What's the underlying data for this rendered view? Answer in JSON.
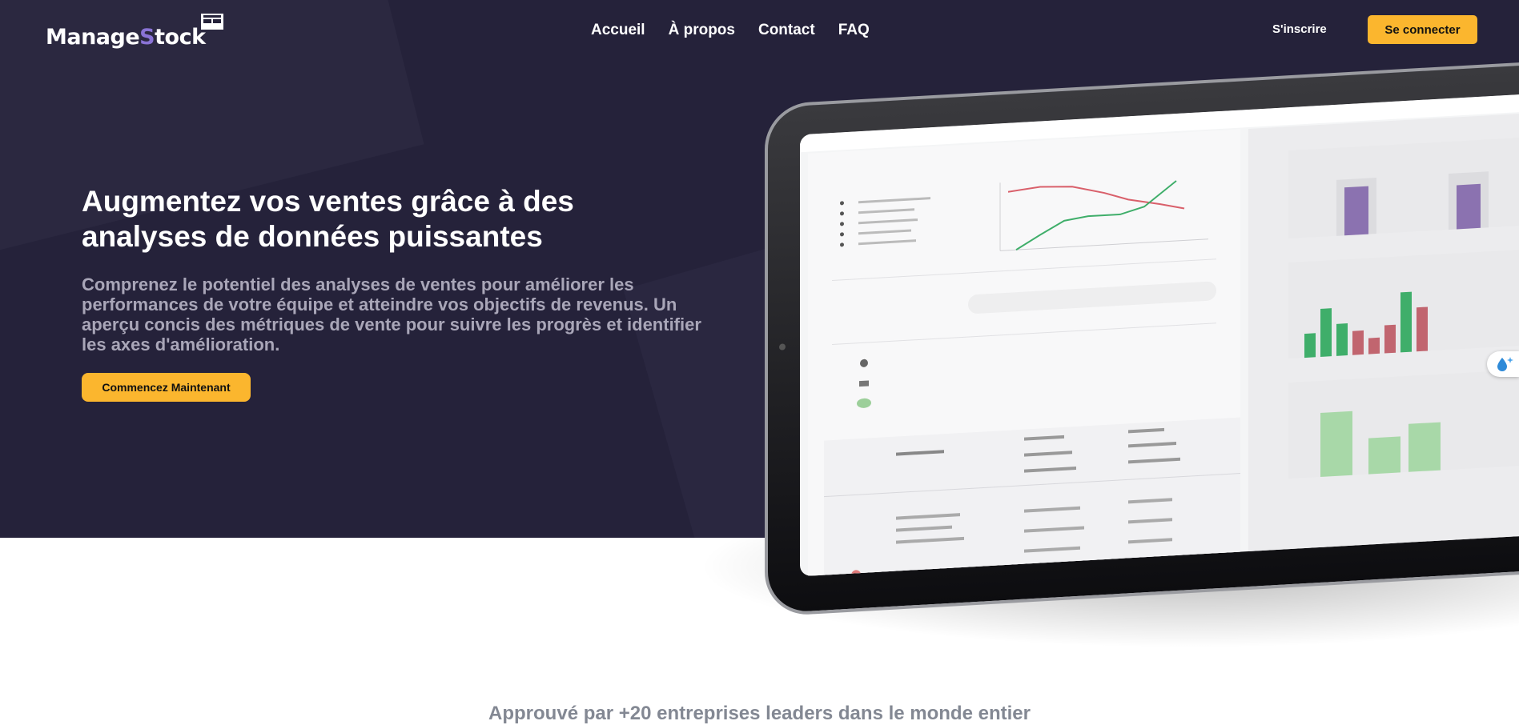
{
  "brand": {
    "name_part1": "Manage",
    "name_accent": "S",
    "name_part2": "tock",
    "accent_color": "#8a73d6",
    "logo_icon": "window-grid-icon"
  },
  "nav": {
    "links": [
      {
        "label": "Accueil"
      },
      {
        "label": "À propos"
      },
      {
        "label": "Contact"
      },
      {
        "label": "FAQ"
      }
    ],
    "signup_label": "S'inscrire",
    "login_label": "Se connecter"
  },
  "hero": {
    "title": "Augmentez vos ventes grâce à des analyses de données puissantes",
    "description": "Comprenez le potentiel des analyses de ventes pour améliorer les performances de votre équipe et atteindre vos objectifs de revenus. Un aperçu concis des métriques de vente pour suivre les progrès et identifier les axes d'amélioration.",
    "cta_label": "Commencez Maintenant",
    "background_color": "#25223a",
    "button_color": "#fbb62e"
  },
  "mockup": {
    "image": "tablet-dashboard-illustration",
    "floating_button_icon": "water-drop-sparkle-icon"
  },
  "trust": {
    "text": "Approuvé par +20 entreprises leaders dans le monde entier"
  }
}
